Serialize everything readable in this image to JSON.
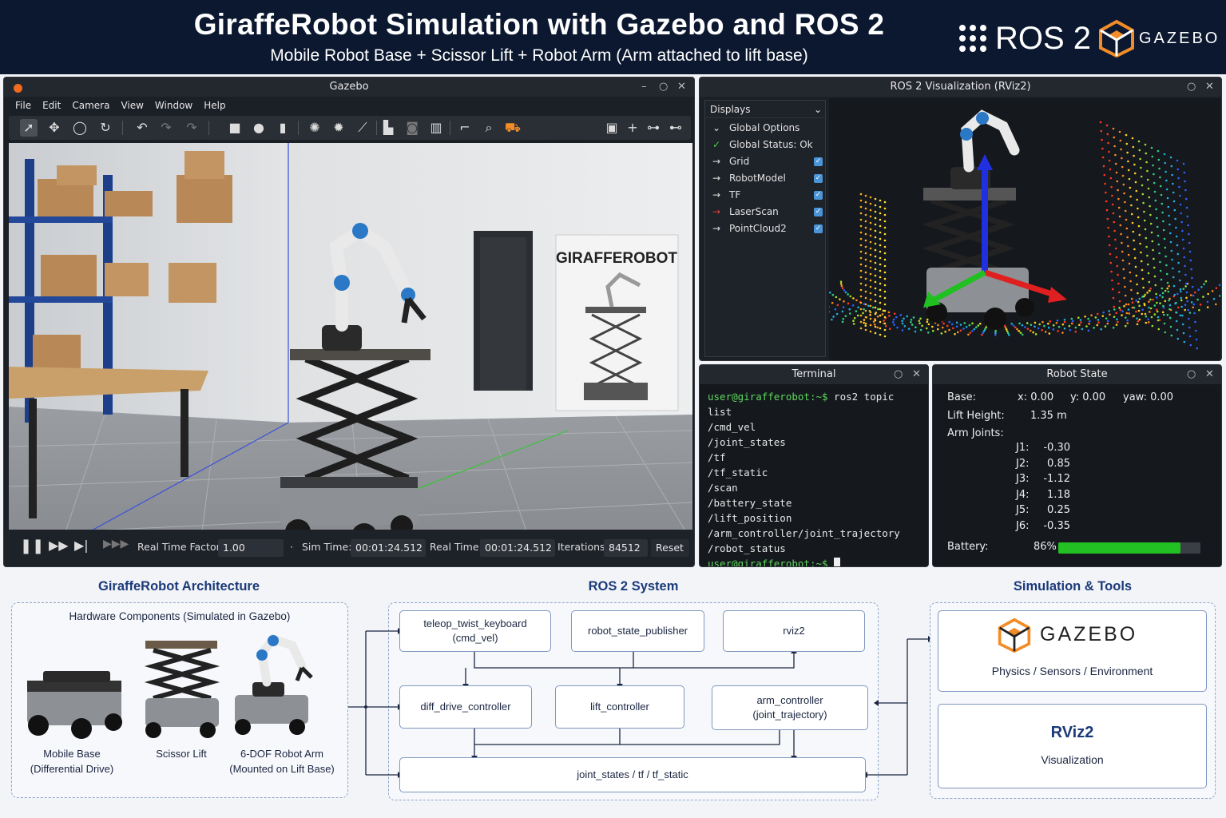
{
  "header": {
    "title": "GiraffeRobot Simulation with Gazebo and ROS 2",
    "subtitle": "Mobile Robot Base + Scissor Lift + Robot Arm (Arm attached to lift base)",
    "ros_logo_text": "ROS 2",
    "gazebo_logo_text": "GAZEBO"
  },
  "gazebo": {
    "title": "Gazebo",
    "menu": [
      "File",
      "Edit",
      "Camera",
      "View",
      "Window",
      "Help"
    ],
    "poster_text": "GIRAFFEROBOT",
    "bottom": {
      "rtf_label": "Real Time Factor:",
      "rtf_value": "1.00",
      "sim_time_label": "Sim Time:",
      "sim_time_value": "00:01:24.512",
      "real_time_label": "Real Time:",
      "real_time_value": "00:01:24.512",
      "iterations_label": "Iterations:",
      "iterations_value": "84512",
      "reset_label": "Reset"
    }
  },
  "rviz": {
    "title": "ROS 2 Visualization (RViz2)",
    "displays_title": "Displays",
    "items": [
      {
        "label": "Global Options",
        "checked": false,
        "arrow": "⌄"
      },
      {
        "label": "Global Status: Ok",
        "checked": false,
        "arrow": "✓"
      },
      {
        "label": "Grid",
        "checked": true,
        "arrow": "→"
      },
      {
        "label": "RobotModel",
        "checked": true,
        "arrow": "→"
      },
      {
        "label": "TF",
        "checked": true,
        "arrow": "→"
      },
      {
        "label": "LaserScan",
        "checked": true,
        "arrow": "→"
      },
      {
        "label": "PointCloud2",
        "checked": true,
        "arrow": "→"
      }
    ]
  },
  "terminal": {
    "title": "Terminal",
    "prompt": "user@girafferobot",
    "prompt_suffix": ":~$ ",
    "command": "ros2 topic list",
    "topics": [
      "/cmd_vel",
      "/joint_states",
      "/tf",
      "/tf_static",
      "/scan",
      "/battery_state",
      "/lift_position",
      "/arm_controller/joint_trajectory",
      "/robot_status"
    ],
    "final_prompt": "user@girafferobot",
    "final_suffix": ":~$"
  },
  "robot_state": {
    "title": "Robot State",
    "base_label": "Base:",
    "x": "x: 0.00",
    "y": "y: 0.00",
    "yaw": "yaw: 0.00",
    "lift_label": "Lift Height:",
    "lift_value": "1.35 m",
    "arm_label": "Arm Joints:",
    "joints": [
      {
        "name": "J1:",
        "value": "-0.30"
      },
      {
        "name": "J2:",
        "value": "0.85"
      },
      {
        "name": "J3:",
        "value": "-1.12"
      },
      {
        "name": "J4:",
        "value": "1.18"
      },
      {
        "name": "J5:",
        "value": "0.25"
      },
      {
        "name": "J6:",
        "value": "-0.35"
      }
    ],
    "battery_label": "Battery:",
    "battery_value": "86%",
    "battery_fraction": 0.86,
    "battery_color": "#22c022"
  },
  "architecture": {
    "title": "GiraffeRobot Architecture",
    "hardware_title": "Hardware Components (Simulated in Gazebo)",
    "components": [
      {
        "name": "Mobile Base",
        "detail": "(Differential Drive)"
      },
      {
        "name": "Scissor Lift",
        "detail": ""
      },
      {
        "name": "6-DOF Robot Arm",
        "detail": "(Mounted on Lift Base)"
      }
    ]
  },
  "ros_system": {
    "title": "ROS 2 System",
    "teleop": "teleop_twist_keyboard",
    "teleop_sub": "(cmd_vel)",
    "rsp": "robot_state_publisher",
    "rviz2": "rviz2",
    "diff": "diff_drive_controller",
    "lift": "lift_controller",
    "arm": "arm_controller",
    "arm_sub": "(joint_trajectory)",
    "topics": "joint_states / tf / tf_static"
  },
  "sim_tools": {
    "title": "Simulation & Tools",
    "gazebo_name": "GAZEBO",
    "gazebo_desc": "Physics / Sensors / Environment",
    "rviz_name": "RViz2",
    "rviz_desc": "Visualization"
  }
}
